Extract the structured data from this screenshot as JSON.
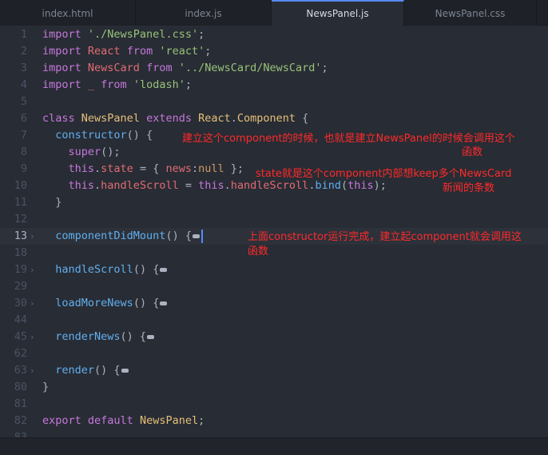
{
  "tabs": [
    {
      "label": "index.html",
      "active": false
    },
    {
      "label": "index.js",
      "active": false
    },
    {
      "label": "NewsPanel.js",
      "active": true
    },
    {
      "label": "NewsPanel.css",
      "active": false
    }
  ],
  "lines": [
    {
      "n": "1",
      "tokens": [
        [
          "kw",
          "import "
        ],
        [
          "str",
          "'./NewsPanel.css'"
        ],
        [
          "plain",
          ";"
        ]
      ]
    },
    {
      "n": "2",
      "tokens": [
        [
          "kw",
          "import "
        ],
        [
          "var",
          "React "
        ],
        [
          "kw",
          "from "
        ],
        [
          "str",
          "'react'"
        ],
        [
          "plain",
          ";"
        ]
      ]
    },
    {
      "n": "3",
      "tokens": [
        [
          "kw",
          "import "
        ],
        [
          "var",
          "NewsCard "
        ],
        [
          "kw",
          "from "
        ],
        [
          "str",
          "'../NewsCard/NewsCard'"
        ],
        [
          "plain",
          ";"
        ]
      ]
    },
    {
      "n": "4",
      "tokens": [
        [
          "kw",
          "import "
        ],
        [
          "var",
          "_ "
        ],
        [
          "kw",
          "from "
        ],
        [
          "str",
          "'lodash'"
        ],
        [
          "plain",
          ";"
        ]
      ]
    },
    {
      "n": "5",
      "tokens": []
    },
    {
      "n": "6",
      "tokens": [
        [
          "kw",
          "class "
        ],
        [
          "cls",
          "NewsPanel "
        ],
        [
          "kw",
          "extends "
        ],
        [
          "cls",
          "React"
        ],
        [
          "plain",
          "."
        ],
        [
          "cls",
          "Component "
        ],
        [
          "plain",
          "{"
        ]
      ]
    },
    {
      "n": "7",
      "tokens": [
        [
          "plain",
          "  "
        ],
        [
          "fn",
          "constructor"
        ],
        [
          "plain",
          "() {"
        ]
      ]
    },
    {
      "n": "8",
      "tokens": [
        [
          "plain",
          "    "
        ],
        [
          "kw",
          "super"
        ],
        [
          "plain",
          "();"
        ]
      ]
    },
    {
      "n": "9",
      "tokens": [
        [
          "plain",
          "    "
        ],
        [
          "kw",
          "this"
        ],
        [
          "plain",
          "."
        ],
        [
          "var",
          "state"
        ],
        [
          "plain",
          " = { "
        ],
        [
          "var",
          "news"
        ],
        [
          "plain",
          ":"
        ],
        [
          "num",
          "null"
        ],
        [
          "plain",
          " };"
        ]
      ]
    },
    {
      "n": "10",
      "tokens": [
        [
          "plain",
          "    "
        ],
        [
          "kw",
          "this"
        ],
        [
          "plain",
          "."
        ],
        [
          "var",
          "handleScroll"
        ],
        [
          "plain",
          " = "
        ],
        [
          "kw",
          "this"
        ],
        [
          "plain",
          "."
        ],
        [
          "var",
          "handleScroll"
        ],
        [
          "plain",
          "."
        ],
        [
          "fn",
          "bind"
        ],
        [
          "plain",
          "("
        ],
        [
          "kw",
          "this"
        ],
        [
          "plain",
          ");"
        ]
      ]
    },
    {
      "n": "11",
      "tokens": [
        [
          "plain",
          "  }"
        ]
      ]
    },
    {
      "n": "12",
      "tokens": []
    },
    {
      "n": "13",
      "fold": true,
      "cursor": true,
      "tokens": [
        [
          "plain",
          "  "
        ],
        [
          "fn",
          "componentDidMount"
        ],
        [
          "plain",
          "() {"
        ]
      ]
    },
    {
      "n": "18",
      "tokens": []
    },
    {
      "n": "19",
      "fold": true,
      "tokens": [
        [
          "plain",
          "  "
        ],
        [
          "fn",
          "handleScroll"
        ],
        [
          "plain",
          "() {"
        ]
      ]
    },
    {
      "n": "29",
      "tokens": []
    },
    {
      "n": "30",
      "fold": true,
      "tokens": [
        [
          "plain",
          "  "
        ],
        [
          "fn",
          "loadMoreNews"
        ],
        [
          "plain",
          "() {"
        ]
      ]
    },
    {
      "n": "44",
      "tokens": []
    },
    {
      "n": "45",
      "fold": true,
      "tokens": [
        [
          "plain",
          "  "
        ],
        [
          "fn",
          "renderNews"
        ],
        [
          "plain",
          "() {"
        ]
      ]
    },
    {
      "n": "62",
      "tokens": []
    },
    {
      "n": "63",
      "fold": true,
      "tokens": [
        [
          "plain",
          "  "
        ],
        [
          "fn",
          "render"
        ],
        [
          "plain",
          "() {"
        ]
      ]
    },
    {
      "n": "80",
      "tokens": [
        [
          "plain",
          "}"
        ]
      ]
    },
    {
      "n": "81",
      "tokens": []
    },
    {
      "n": "82",
      "tokens": [
        [
          "kw",
          "export "
        ],
        [
          "kw",
          "default "
        ],
        [
          "cls",
          "NewsPanel"
        ],
        [
          "plain",
          ";"
        ]
      ]
    },
    {
      "n": "83",
      "tokens": []
    }
  ],
  "annotations": [
    {
      "id": "note-1a",
      "text": "建立这个component的时候，也就是建立NewsPanel的时候会调用这个"
    },
    {
      "id": "note-1b",
      "text": "函数"
    },
    {
      "id": "note-2a",
      "text": "state就是这个component内部想keep多个NewsCard"
    },
    {
      "id": "note-2b",
      "text": "新闻的条数"
    },
    {
      "id": "note-3a",
      "text": "上面constructor运行完成，建立起component就会调用这"
    },
    {
      "id": "note-3b",
      "text": "函数"
    }
  ],
  "colors": {
    "background": "#282c34",
    "annotation": "#ff2a2a",
    "active_tab_accent": "#568af2"
  },
  "icons": {
    "fold_marker": "chevron-right-icon",
    "folded_body": "ellipsis-icon"
  }
}
